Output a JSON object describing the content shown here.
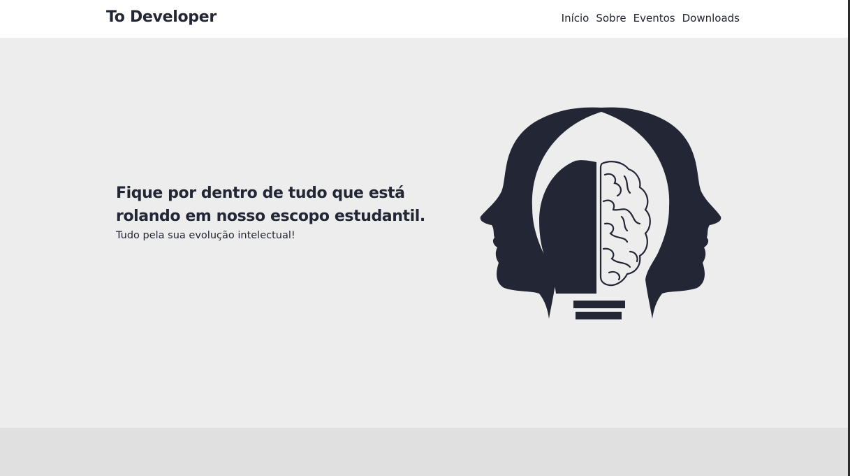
{
  "header": {
    "brand": "To Developer",
    "nav": [
      "Início",
      "Sobre",
      "Eventos",
      "Downloads"
    ]
  },
  "hero": {
    "headline": "Fique por dentro de tudo que está rolando em nosso escopo estudantil.",
    "subline": "Tudo pela sua evolução intelectual!",
    "illustration": "heads-lightbulb-brain-icon"
  },
  "colors": {
    "text": "#232634",
    "topbar": "#ffffff",
    "hero_bg": "#ededed",
    "footer_bg": "#e0e0e0"
  }
}
